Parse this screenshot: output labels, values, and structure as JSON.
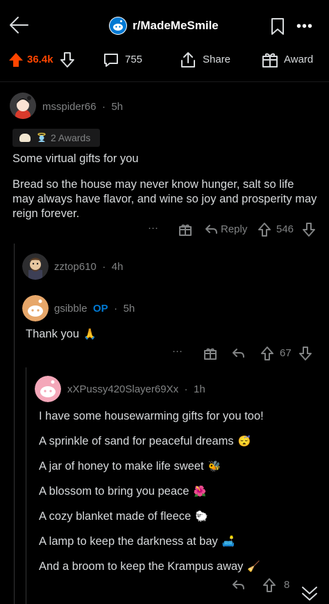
{
  "header": {
    "subreddit": "r/MadeMeSmile"
  },
  "post_actions": {
    "votes": "36.4k",
    "comments": "755",
    "share_label": "Share",
    "award_label": "Award",
    "upvote_color": "#ff4500"
  },
  "comments": [
    {
      "username": "msspider66",
      "time": "5h",
      "awards_label": "2 Awards",
      "paragraphs": [
        "Some virtual gifts for you",
        "Bread so the house may never know hunger, salt so life may always have flavor, and wine so joy and prosperity may reign forever."
      ],
      "actions": {
        "more": "···",
        "reply_label": "Reply",
        "votes": "546"
      }
    },
    {
      "username": "zztop610",
      "time": "4h"
    },
    {
      "username": "gsibble",
      "op_badge": "OP",
      "time": "5h",
      "text": "Thank you",
      "text_emoji": "🙏",
      "actions": {
        "more": "···",
        "votes": "67"
      }
    },
    {
      "username": "xXPussy420Slayer69Xx",
      "time": "1h",
      "lines": [
        {
          "text": "I have some housewarming gifts for you too!",
          "emoji": ""
        },
        {
          "text": "A sprinkle of sand for peaceful dreams",
          "emoji": "😴"
        },
        {
          "text": "A jar of honey to make life sweet",
          "emoji": "🐝"
        },
        {
          "text": "A blossom to bring you peace",
          "emoji": "🌺"
        },
        {
          "text": "A cozy blanket made of fleece",
          "emoji": "🐑"
        },
        {
          "text": "A lamp to keep the darkness at bay",
          "emoji": "🛋️"
        },
        {
          "text": "And a broom to keep the Krampus away",
          "emoji": "🧹"
        }
      ],
      "actions": {
        "votes": "8"
      }
    }
  ],
  "separators": {
    "dot": "·"
  },
  "colors": {
    "background": "#000000",
    "text": "#d7dadc",
    "muted": "#818384",
    "op_blue": "#0079d3",
    "thread_line": "#343536"
  }
}
